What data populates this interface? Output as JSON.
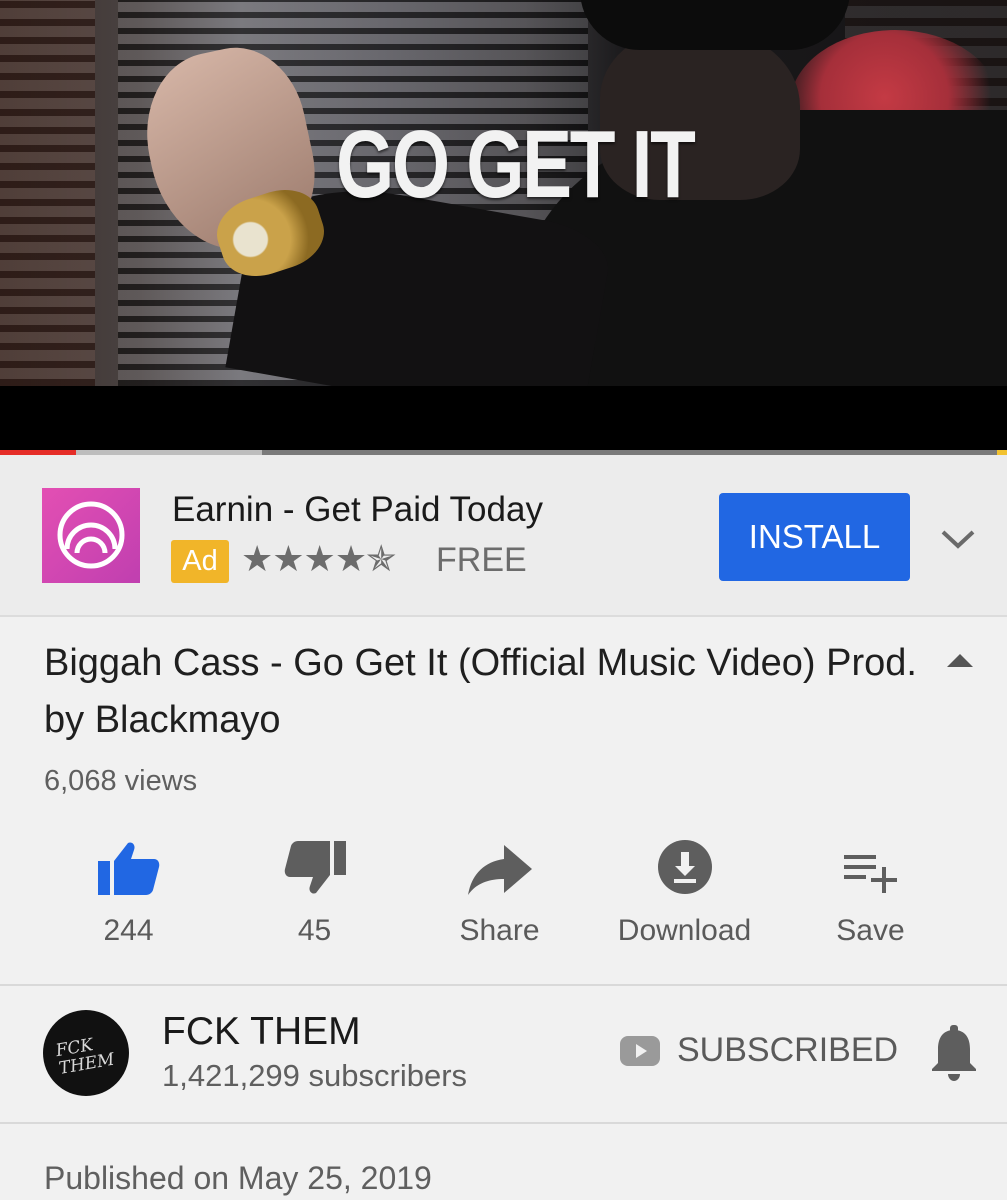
{
  "player": {
    "overlay_text": "GO GET IT",
    "progress_played": 0.075,
    "progress_buffered": 0.26,
    "colors": {
      "played": "#e52d27",
      "ad_marker": "#f2c230"
    }
  },
  "ad": {
    "title": "Earnin - Get Paid Today",
    "badge": "Ad",
    "rating": 4.5,
    "stars_text": "★★★★✯",
    "price": "FREE",
    "install_label": "INSTALL",
    "icon": "earnin-logo",
    "expand_icon": "chevron-down-icon",
    "colors": {
      "install": "#2167e3",
      "badge": "#f1b529"
    }
  },
  "video": {
    "title": "Biggah Cass - Go Get It (Official Music Video) Prod. by Blackmayo",
    "views": "6,068 views",
    "collapse_icon": "triangle-up-icon"
  },
  "actions": [
    {
      "icon": "thumbs-up-icon",
      "label": "244"
    },
    {
      "icon": "thumbs-down-icon",
      "label": "45"
    },
    {
      "icon": "share-icon",
      "label": "Share"
    },
    {
      "icon": "download-icon",
      "label": "Download"
    },
    {
      "icon": "save-playlist-icon",
      "label": "Save"
    }
  ],
  "channel": {
    "name": "FCK THEM",
    "subscribers": "1,421,299 subscribers",
    "subscribe_label": "SUBSCRIBED",
    "avatar_text": "FCK THEM",
    "bell_icon": "bell-icon"
  },
  "published": "Published on May 25, 2019"
}
